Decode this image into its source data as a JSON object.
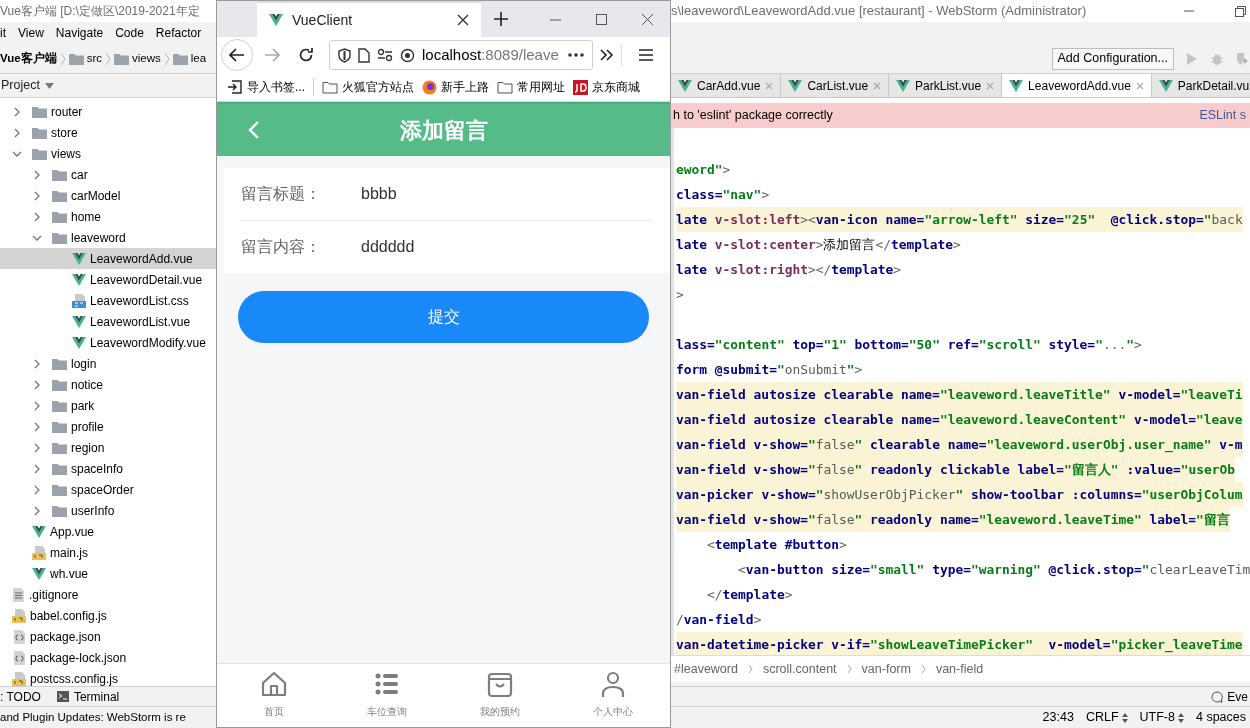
{
  "ide": {
    "title_left": "Vue客户端 [D:\\定做区\\2019-2021年定",
    "title_right": "s\\leaveword\\LeavewordAdd.vue [restaurant] - WebStorm (Administrator)",
    "menu": [
      "it",
      "View",
      "Navigate",
      "Code",
      "Refactor"
    ],
    "breadcrumbs": [
      "Vue客户端",
      "src",
      "views",
      "lea"
    ],
    "run_config_button": "Add Configuration...",
    "project_panel": {
      "title": "Project",
      "items": [
        {
          "label": "router",
          "kind": "folder",
          "expanded": false,
          "selected": false
        },
        {
          "label": "store",
          "kind": "folder",
          "expanded": false,
          "selected": false
        },
        {
          "label": "views",
          "kind": "folder",
          "expanded": true,
          "selected": false,
          "children": [
            {
              "label": "car",
              "kind": "folder",
              "expanded": false,
              "selected": false
            },
            {
              "label": "carModel",
              "kind": "folder",
              "expanded": false,
              "selected": false
            },
            {
              "label": "home",
              "kind": "folder",
              "expanded": false,
              "selected": false
            },
            {
              "label": "leaveword",
              "kind": "folder",
              "expanded": true,
              "selected": false,
              "children": [
                {
                  "label": "LeavewordAdd.vue",
                  "kind": "vue",
                  "selected": true
                },
                {
                  "label": "LeavewordDetail.vue",
                  "kind": "vue",
                  "selected": false
                },
                {
                  "label": "LeavewordList.css",
                  "kind": "css",
                  "selected": false
                },
                {
                  "label": "LeavewordList.vue",
                  "kind": "vue",
                  "selected": false
                },
                {
                  "label": "LeavewordModify.vue",
                  "kind": "vue",
                  "selected": false
                }
              ]
            },
            {
              "label": "login",
              "kind": "folder",
              "expanded": false,
              "selected": false
            },
            {
              "label": "notice",
              "kind": "folder",
              "expanded": false,
              "selected": false
            },
            {
              "label": "park",
              "kind": "folder",
              "expanded": false,
              "selected": false
            },
            {
              "label": "profile",
              "kind": "folder",
              "expanded": false,
              "selected": false
            },
            {
              "label": "region",
              "kind": "folder",
              "expanded": false,
              "selected": false
            },
            {
              "label": "spaceInfo",
              "kind": "folder",
              "expanded": false,
              "selected": false
            },
            {
              "label": "spaceOrder",
              "kind": "folder",
              "expanded": false,
              "selected": false
            },
            {
              "label": "userInfo",
              "kind": "folder",
              "expanded": false,
              "selected": false
            }
          ]
        },
        {
          "label": "App.vue",
          "kind": "vue",
          "selected": false
        },
        {
          "label": "main.js",
          "kind": "js",
          "selected": false
        },
        {
          "label": "wh.vue",
          "kind": "vue",
          "selected": false
        }
      ],
      "root_items": [
        {
          "label": ".gitignore",
          "kind": "text",
          "selected": false
        },
        {
          "label": "babel.config.js",
          "kind": "js",
          "selected": false
        },
        {
          "label": "package.json",
          "kind": "json",
          "selected": false
        },
        {
          "label": "package-lock.json",
          "kind": "json",
          "selected": false
        },
        {
          "label": "postcss.config.js",
          "kind": "js",
          "selected": false
        }
      ]
    },
    "editor_tabs": [
      {
        "label": "CarAdd.vue",
        "selected": false,
        "close_button": true
      },
      {
        "label": "CarList.vue",
        "selected": false,
        "close_button": true
      },
      {
        "label": "ParkList.vue",
        "selected": false,
        "close_button": true
      },
      {
        "label": "LeavewordAdd.vue",
        "selected": true,
        "close_button": true
      },
      {
        "label": "ParkDetail.vu",
        "selected": false,
        "close_button": false
      }
    ],
    "eslint_banner": {
      "message": "h to 'eslint' package correctly",
      "link": "ESLint s"
    },
    "code_blocks": [
      {
        "lines": [
          {
            "highlighted": false,
            "segments": [
              {
                "kind": "string",
                "text": "eword\""
              },
              {
                "kind": "punct",
                "text": ">"
              }
            ]
          },
          {
            "highlighted": false,
            "segments": [
              {
                "kind": "attr",
                "text": "class="
              },
              {
                "kind": "string",
                "text": "\"nav\""
              },
              {
                "kind": "punct",
                "text": ">"
              }
            ]
          },
          {
            "highlighted": true,
            "segments": [
              {
                "kind": "tag",
                "text": "late "
              },
              {
                "kind": "directive",
                "text": "v-slot:left"
              },
              {
                "kind": "punct",
                "text": "><"
              },
              {
                "kind": "tag",
                "text": "van-icon "
              },
              {
                "kind": "attr",
                "text": "name="
              },
              {
                "kind": "string",
                "text": "\"arrow-left\" "
              },
              {
                "kind": "attr",
                "text": "size="
              },
              {
                "kind": "string",
                "text": "\"25\"  "
              },
              {
                "kind": "attr",
                "text": "@click.stop="
              },
              {
                "kind": "string",
                "text": "\""
              },
              {
                "kind": "expr",
                "text": "back"
              }
            ]
          },
          {
            "highlighted": false,
            "segments": [
              {
                "kind": "tag",
                "text": "late "
              },
              {
                "kind": "directive",
                "text": "v-slot:center"
              },
              {
                "kind": "punct",
                "text": ">"
              },
              {
                "kind": "text",
                "text": "添加留言"
              },
              {
                "kind": "punct",
                "text": "</"
              },
              {
                "kind": "tag",
                "text": "template"
              },
              {
                "kind": "punct",
                "text": ">"
              }
            ]
          },
          {
            "highlighted": false,
            "segments": [
              {
                "kind": "tag",
                "text": "late "
              },
              {
                "kind": "directive",
                "text": "v-slot:right"
              },
              {
                "kind": "punct",
                "text": "></"
              },
              {
                "kind": "tag",
                "text": "template"
              },
              {
                "kind": "punct",
                "text": ">"
              }
            ]
          },
          {
            "highlighted": false,
            "segments": [
              {
                "kind": "punct",
                "text": ">"
              }
            ]
          }
        ]
      },
      {
        "lines": [
          {
            "highlighted": false,
            "segments": [
              {
                "kind": "attr",
                "text": "lass="
              },
              {
                "kind": "string",
                "text": "\"content\" "
              },
              {
                "kind": "attr",
                "text": "top="
              },
              {
                "kind": "string",
                "text": "\"1\" "
              },
              {
                "kind": "attr",
                "text": "bottom="
              },
              {
                "kind": "string",
                "text": "\"50\" "
              },
              {
                "kind": "attr",
                "text": "ref="
              },
              {
                "kind": "string",
                "text": "\"scroll\" "
              },
              {
                "kind": "attr",
                "text": "style="
              },
              {
                "kind": "string",
                "text": "\""
              },
              {
                "kind": "expr",
                "text": "..."
              },
              {
                "kind": "string",
                "text": "\""
              },
              {
                "kind": "punct",
                "text": ">"
              }
            ]
          },
          {
            "highlighted": false,
            "segments": [
              {
                "kind": "tag",
                "text": "form "
              },
              {
                "kind": "attr",
                "text": "@submit="
              },
              {
                "kind": "string",
                "text": "\""
              },
              {
                "kind": "expr",
                "text": "onSubmit"
              },
              {
                "kind": "string",
                "text": "\""
              },
              {
                "kind": "punct",
                "text": ">"
              }
            ]
          },
          {
            "highlighted": true,
            "segments": [
              {
                "kind": "tag",
                "text": "van-field "
              },
              {
                "kind": "attr",
                "text": "autosize clearable name="
              },
              {
                "kind": "string",
                "text": "\"leaveword.leaveTitle\" "
              },
              {
                "kind": "attr",
                "text": "v-model="
              },
              {
                "kind": "string",
                "text": "\"leaveTi"
              }
            ]
          },
          {
            "highlighted": true,
            "segments": [
              {
                "kind": "tag",
                "text": "van-field "
              },
              {
                "kind": "attr",
                "text": "autosize clearable name="
              },
              {
                "kind": "string",
                "text": "\"leaveword.leaveContent\" "
              },
              {
                "kind": "attr",
                "text": "v-model="
              },
              {
                "kind": "string",
                "text": "\"leave"
              }
            ]
          },
          {
            "highlighted": true,
            "segments": [
              {
                "kind": "tag",
                "text": "van-field "
              },
              {
                "kind": "attr",
                "text": "v-show="
              },
              {
                "kind": "string",
                "text": "\""
              },
              {
                "kind": "expr",
                "text": "false"
              },
              {
                "kind": "string",
                "text": "\" "
              },
              {
                "kind": "attr",
                "text": "clearable name="
              },
              {
                "kind": "string",
                "text": "\"leaveword.userObj.user_name\" "
              },
              {
                "kind": "attr",
                "text": "v-m"
              }
            ]
          },
          {
            "highlighted": true,
            "segments": [
              {
                "kind": "tag",
                "text": "van-field "
              },
              {
                "kind": "attr",
                "text": "v-show="
              },
              {
                "kind": "string",
                "text": "\""
              },
              {
                "kind": "expr",
                "text": "false"
              },
              {
                "kind": "string",
                "text": "\" "
              },
              {
                "kind": "attr",
                "text": "readonly clickable label="
              },
              {
                "kind": "string",
                "text": "\"留言人\" "
              },
              {
                "kind": "attr",
                "text": ":value="
              },
              {
                "kind": "string",
                "text": "\"userOb"
              }
            ]
          },
          {
            "highlighted": true,
            "segments": [
              {
                "kind": "tag",
                "text": "van-picker "
              },
              {
                "kind": "attr",
                "text": "v-show="
              },
              {
                "kind": "string",
                "text": "\""
              },
              {
                "kind": "expr",
                "text": "showUserObjPicker"
              },
              {
                "kind": "string",
                "text": "\" "
              },
              {
                "kind": "attr",
                "text": "show-toolbar :columns="
              },
              {
                "kind": "string",
                "text": "\"userObjColum"
              }
            ]
          },
          {
            "highlighted": true,
            "segments": [
              {
                "kind": "tag",
                "text": "van-field "
              },
              {
                "kind": "attr",
                "text": "v-show="
              },
              {
                "kind": "string",
                "text": "\""
              },
              {
                "kind": "expr",
                "text": "false"
              },
              {
                "kind": "string",
                "text": "\" "
              },
              {
                "kind": "attr",
                "text": "readonly name="
              },
              {
                "kind": "string",
                "text": "\"leaveword.leaveTime\" "
              },
              {
                "kind": "attr",
                "text": "label="
              },
              {
                "kind": "string",
                "text": "\"留言"
              }
            ]
          },
          {
            "highlighted": false,
            "segments": [
              {
                "kind": "punct",
                "text": "    <"
              },
              {
                "kind": "tag",
                "text": "template #button"
              },
              {
                "kind": "punct",
                "text": ">"
              }
            ]
          },
          {
            "highlighted": false,
            "segments": [
              {
                "kind": "punct",
                "text": "        <"
              },
              {
                "kind": "tag",
                "text": "van-button "
              },
              {
                "kind": "attr",
                "text": "size="
              },
              {
                "kind": "string",
                "text": "\"small\" "
              },
              {
                "kind": "attr",
                "text": "type="
              },
              {
                "kind": "string",
                "text": "\"warning\" "
              },
              {
                "kind": "attr",
                "text": "@click.stop="
              },
              {
                "kind": "string",
                "text": "\""
              },
              {
                "kind": "expr",
                "text": "clearLeaveTim"
              }
            ]
          },
          {
            "highlighted": false,
            "segments": [
              {
                "kind": "punct",
                "text": "    </"
              },
              {
                "kind": "tag",
                "text": "template"
              },
              {
                "kind": "punct",
                "text": ">"
              }
            ]
          },
          {
            "highlighted": false,
            "segments": [
              {
                "kind": "punct",
                "text": "/"
              },
              {
                "kind": "tag",
                "text": "van-field"
              },
              {
                "kind": "punct",
                "text": ">"
              }
            ]
          },
          {
            "highlighted": true,
            "segments": [
              {
                "kind": "tag",
                "text": "van-datetime-picker "
              },
              {
                "kind": "attr",
                "text": "v-if="
              },
              {
                "kind": "string",
                "text": "\"showLeaveTimePicker\"  "
              },
              {
                "kind": "attr",
                "text": "v-model="
              },
              {
                "kind": "string",
                "text": "\"picker_leaveTime"
              }
            ]
          }
        ]
      }
    ],
    "code_breadcrumbs": [
      "#leaveword",
      "scroll.content",
      "van-form",
      "van-field"
    ],
    "tool_windows": [
      {
        "label": ": TODO",
        "kind": "todo"
      },
      {
        "label": "Terminal",
        "kind": "terminal"
      }
    ],
    "event_log": "Eve",
    "status_message": "and Plugin Updates: WebStorm is re",
    "status_items": [
      {
        "label": "23:43",
        "kind": "plain"
      },
      {
        "label": "CRLF",
        "kind": "menu"
      },
      {
        "label": "UTF-8",
        "kind": "menu"
      },
      {
        "label": "4 spaces",
        "kind": "plain"
      }
    ]
  },
  "browser": {
    "tab_title": "VueClient",
    "url_host": "localhost",
    "url_path": ":8089/leave",
    "bookmarks": [
      {
        "label": "导入书签...",
        "kind": "import"
      },
      {
        "label": "火狐官方站点",
        "kind": "folder"
      },
      {
        "label": "新手上路",
        "kind": "globe"
      },
      {
        "label": "常用网址",
        "kind": "folder"
      },
      {
        "label": "京东商城",
        "kind": "shop"
      }
    ],
    "page": {
      "title": "添加留言",
      "fields": [
        {
          "label": "留言标题：",
          "value": "bbbb"
        },
        {
          "label": "留言内容：",
          "value": "dddddd"
        }
      ],
      "submit": "提交",
      "tabbar": [
        {
          "label": "首页",
          "kind": "home",
          "selected": false
        },
        {
          "label": "车位查询",
          "kind": "list",
          "selected": false
        },
        {
          "label": "我的预约",
          "kind": "bag",
          "selected": false
        },
        {
          "label": "个人中心",
          "kind": "person",
          "selected": false
        }
      ]
    }
  }
}
